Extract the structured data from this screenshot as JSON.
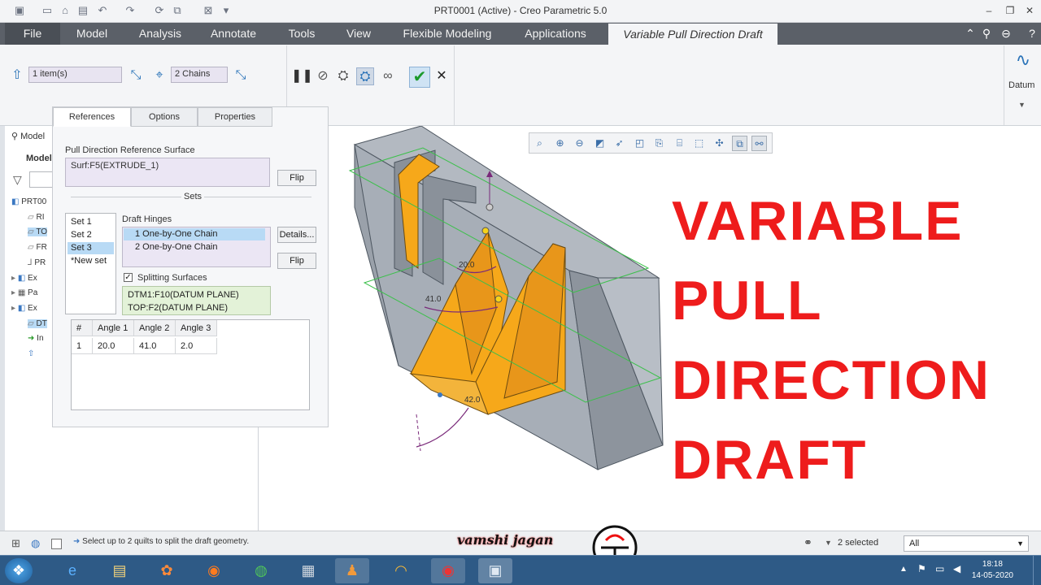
{
  "window": {
    "title": "PRT0001 (Active) - Creo Parametric 5.0"
  },
  "ribbon_tabs": [
    "File",
    "Model",
    "Analysis",
    "Annotate",
    "Tools",
    "View",
    "Flexible Modeling",
    "Applications",
    "Variable Pull Direction Draft"
  ],
  "ribbon": {
    "pull_dir_field": "1 item(s)",
    "hinges_field": "2 Chains",
    "datum_label": "Datum"
  },
  "model_tree": {
    "header": "Model",
    "title": "Model",
    "root": "PRT00",
    "items": [
      "RI",
      "TO",
      "FR",
      "PR",
      "Ex",
      "Pa",
      "Ex",
      "DT",
      "In"
    ]
  },
  "panel": {
    "tabs": [
      "References",
      "Options",
      "Properties"
    ],
    "pull_ref_label": "Pull Direction Reference Surface",
    "pull_ref_value": "Surf:F5(EXTRUDE_1)",
    "flip_label": "Flip",
    "sets_label": "Sets",
    "sets": [
      "Set 1",
      "Set 2",
      "Set 3",
      "*New set"
    ],
    "draft_hinges_label": "Draft Hinges",
    "hinges": [
      "1 One-by-One Chain",
      "2 One-by-One Chain"
    ],
    "details_label": "Details...",
    "flip2_label": "Flip",
    "splitting_label": "Splitting Surfaces",
    "splitting": [
      "DTM1:F10(DATUM PLANE)",
      "TOP:F2(DATUM PLANE)"
    ],
    "table_headers": [
      "#",
      "Angle 1",
      "Angle 2",
      "Angle 3"
    ],
    "table_rows": [
      [
        "1",
        "20.0",
        "41.0",
        "2.0"
      ]
    ]
  },
  "graphics": {
    "dims": [
      "20.0",
      "41.0",
      "42.0"
    ],
    "overlay_lines": [
      "VARIABLE",
      "PULL",
      "DIRECTION",
      "DRAFT"
    ],
    "watermark": "vamshi jagan"
  },
  "status": {
    "message": "Select up to 2 quilts to split the draft geometry.",
    "selected": "2 selected",
    "filter": "All"
  },
  "taskbar": {
    "time": "18:18",
    "date": "14-05-2020"
  },
  "colors": {
    "accent": "#ee1c1c",
    "part_gray": "#a8afb8",
    "draft_orange": "#f6a81a",
    "selection_blue": "#b8daf5"
  }
}
